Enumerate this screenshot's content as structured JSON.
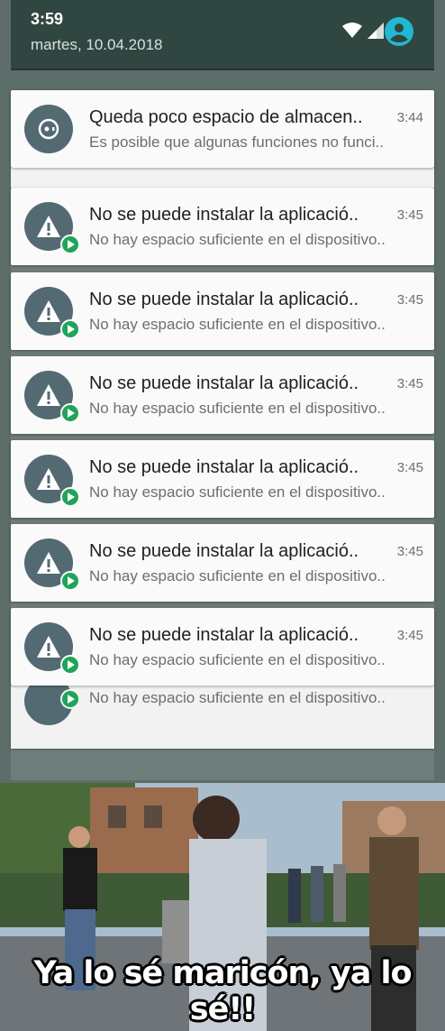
{
  "status_bar": {
    "time": "3:59",
    "date": "martes, 10.04.2018",
    "icons": [
      "wifi-icon",
      "signal-icon",
      "battery-icon",
      "account-icon"
    ]
  },
  "notifications": [
    {
      "icon": "storage-icon",
      "title": "Queda poco espacio de almacen..",
      "text": "Es posible que algunas funciones no funci..",
      "time": "3:44",
      "badge": false
    },
    {
      "icon": "warning-icon",
      "title": "No se puede instalar la aplicació..",
      "text": "No hay espacio suficiente en el dispositivo..",
      "time": "3:45",
      "badge": true
    },
    {
      "icon": "warning-icon",
      "title": "No se puede instalar la aplicació..",
      "text": "No hay espacio suficiente en el dispositivo..",
      "time": "3:45",
      "badge": true
    },
    {
      "icon": "warning-icon",
      "title": "No se puede instalar la aplicació..",
      "text": "No hay espacio suficiente en el dispositivo..",
      "time": "3:45",
      "badge": true
    },
    {
      "icon": "warning-icon",
      "title": "No se puede instalar la aplicació..",
      "text": "No hay espacio suficiente en el dispositivo..",
      "time": "3:45",
      "badge": true
    },
    {
      "icon": "warning-icon",
      "title": "No se puede instalar la aplicació..",
      "text": "No hay espacio suficiente en el dispositivo..",
      "time": "3:45",
      "badge": true
    },
    {
      "icon": "warning-icon",
      "title": "No se puede instalar la aplicació..",
      "text": "No hay espacio suficiente en el dispositivo..",
      "time": "3:45",
      "badge": true
    }
  ],
  "stacked_notification": {
    "text": "No hay espacio suficiente en el dispositivo.."
  },
  "meme": {
    "caption": "Ya lo sé maricón, ya lo sé!!"
  },
  "colors": {
    "shade_header": "#2f4641",
    "card": "#fafafa",
    "icon_circle": "#546a72",
    "play_badge": "#1fa45a",
    "avatar": "#22b8cf"
  }
}
